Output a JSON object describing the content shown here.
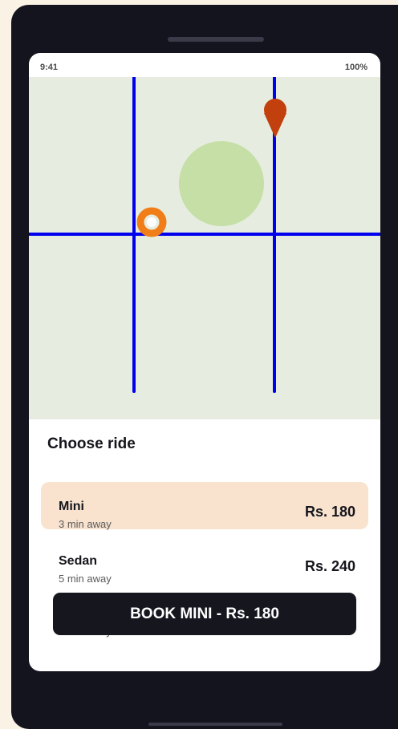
{
  "status_bar": {
    "time": "9:41",
    "battery": "100%"
  },
  "sheet": {
    "title": "Choose ride"
  },
  "rides": [
    {
      "name": "Mini",
      "eta": "3 min away",
      "price": "Rs. 180",
      "selected": true
    },
    {
      "name": "Sedan",
      "eta": "5 min away",
      "price": "Rs. 240",
      "selected": false
    },
    {
      "name": "",
      "eta": "2 min away",
      "price": "",
      "selected": false
    }
  ],
  "book_button": {
    "label": "BOOK MINI - Rs. 180"
  },
  "colors": {
    "map_bg": "#e6ede0",
    "road": "#0000ee",
    "park": "#c5dfa7",
    "pickup_marker": "#f07d17",
    "destination_pin": "#c1400e",
    "selected_ride_bg": "#f9e3cf",
    "button_bg": "#16161f"
  },
  "icons": {
    "pickup": "pickup-marker-icon",
    "destination": "destination-pin-icon"
  }
}
